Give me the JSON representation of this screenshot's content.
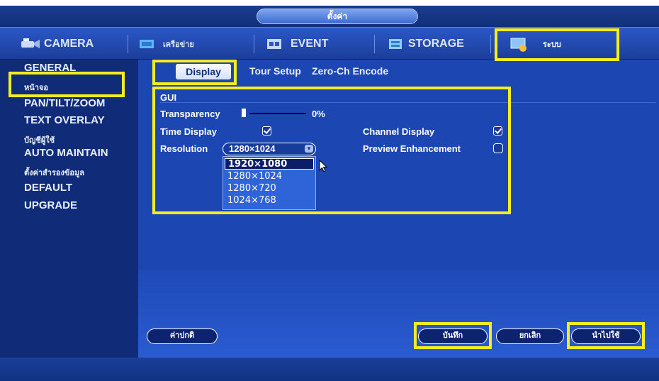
{
  "window": {
    "title": "ตั้งค่า"
  },
  "tabs": [
    {
      "label": "CAMERA",
      "icon": "camera-icon"
    },
    {
      "label": "เครือข่าย",
      "icon": "network-icon"
    },
    {
      "label": "EVENT",
      "icon": "event-icon"
    },
    {
      "label": "STORAGE",
      "icon": "storage-icon"
    },
    {
      "label": "ระบบ",
      "icon": "system-icon"
    }
  ],
  "sidebar": {
    "items": [
      {
        "label": "GENERAL"
      },
      {
        "label": "หน้าจอ"
      },
      {
        "label": "PAN/TILT/ZOOM"
      },
      {
        "label": "TEXT OVERLAY"
      },
      {
        "label": "บัญชีผู้ใช้"
      },
      {
        "label": "AUTO MAINTAIN"
      },
      {
        "label": "ตั้งค่าสำรองข้อมูล"
      },
      {
        "label": "DEFAULT"
      },
      {
        "label": "UPGRADE"
      }
    ]
  },
  "subtabs": [
    {
      "label": "Display"
    },
    {
      "label": "Tour Setup"
    },
    {
      "label": "Zero-Ch Encode"
    }
  ],
  "gui": {
    "group_label": "GUI",
    "transparency_label": "Transparency",
    "transparency_value": "0%",
    "time_display_label": "Time Display",
    "time_display_checked": true,
    "channel_display_label": "Channel Display",
    "channel_display_checked": true,
    "preview_enhancement_label": "Preview Enhancement",
    "preview_enhancement_checked": false,
    "resolution_label": "Resolution",
    "resolution_value": "1280×1024",
    "resolution_options": [
      "1920×1080",
      "1280×1024",
      "1280×720",
      "1024×768"
    ],
    "resolution_highlighted": "1920×1080"
  },
  "buttons": {
    "default": "ค่าปกติ",
    "save": "บันทึก",
    "cancel": "ยกเลิก",
    "apply": "นำไปใช้"
  },
  "colors": {
    "highlight": "#f4ee1f",
    "background": "#0f2a73",
    "panel": "#1c47b3"
  }
}
